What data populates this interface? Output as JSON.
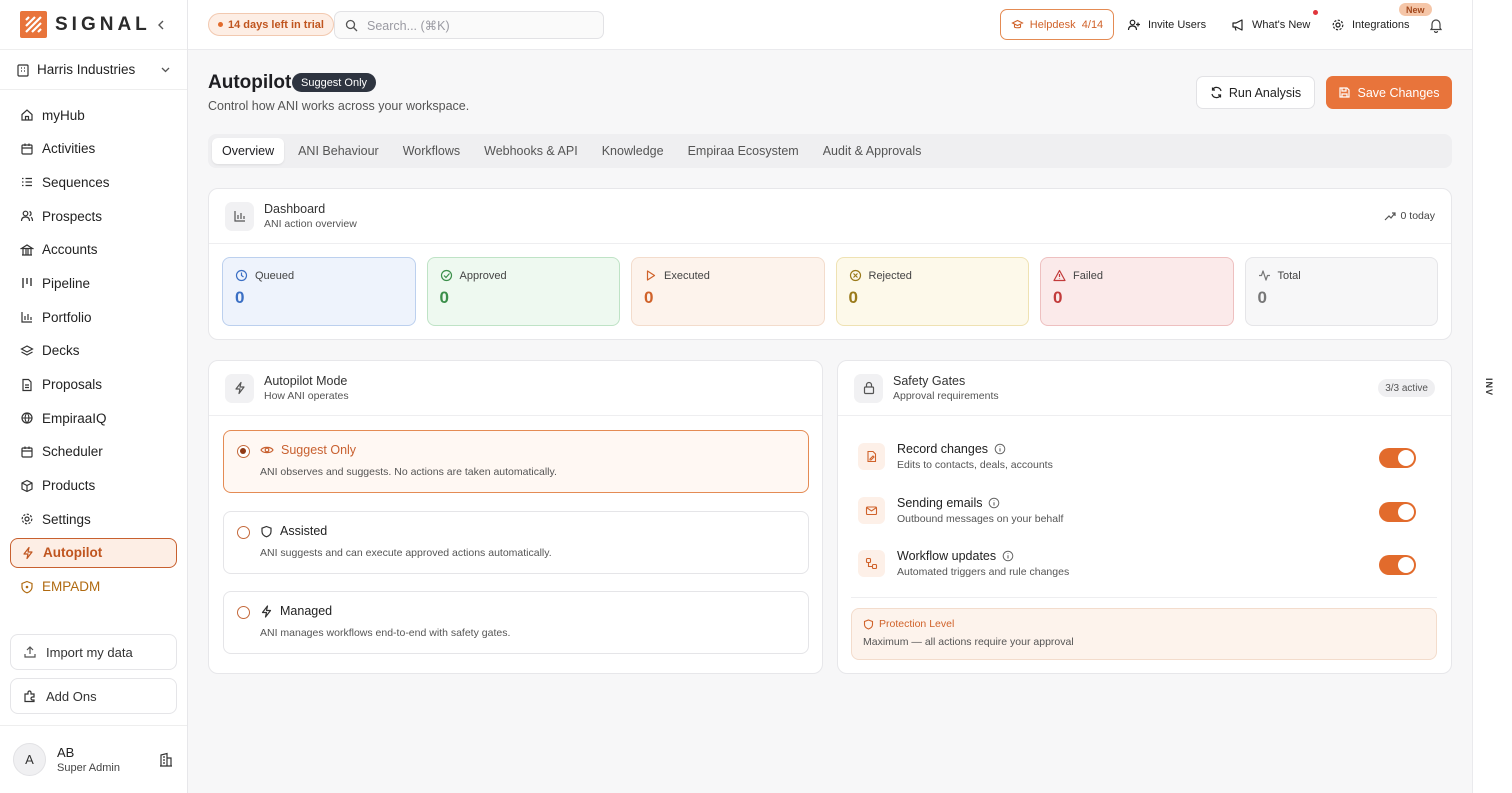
{
  "brand": {
    "name": "SIGNAL",
    "accent": "#e8743b"
  },
  "workspace": {
    "name": "Harris Industries"
  },
  "sidebar": {
    "items": [
      {
        "label": "myHub",
        "icon": "home-icon"
      },
      {
        "label": "Activities",
        "icon": "calendar-icon"
      },
      {
        "label": "Sequences",
        "icon": "list-icon"
      },
      {
        "label": "Prospects",
        "icon": "users-icon"
      },
      {
        "label": "Accounts",
        "icon": "building-icon"
      },
      {
        "label": "Pipeline",
        "icon": "pipeline-icon"
      },
      {
        "label": "Portfolio",
        "icon": "bar-chart-icon"
      },
      {
        "label": "Decks",
        "icon": "layers-icon"
      },
      {
        "label": "Proposals",
        "icon": "document-icon"
      },
      {
        "label": "EmpiraaIQ",
        "icon": "globe-icon"
      },
      {
        "label": "Scheduler",
        "icon": "calendar-icon"
      },
      {
        "label": "Products",
        "icon": "box-icon"
      },
      {
        "label": "Settings",
        "icon": "gear-icon"
      },
      {
        "label": "Autopilot",
        "icon": "bolt-icon"
      },
      {
        "label": "EMPADM",
        "icon": "shield-icon"
      }
    ],
    "import_label": "Import my data",
    "addons_label": "Add Ons"
  },
  "user": {
    "initial": "A",
    "name": "AB",
    "role": "Super Admin"
  },
  "topbar": {
    "trial": "14 days left in trial",
    "search_placeholder": "Search... (⌘K)",
    "helpdesk": "Helpdesk  4/14",
    "invite": "Invite Users",
    "whats_new": "What's New",
    "integrations": "Integrations",
    "new_badge": "New"
  },
  "page": {
    "title": "Autopilot",
    "mode_badge": "Suggest Only",
    "subtitle": "Control how ANI works across your workspace.",
    "run_label": "Run Analysis",
    "save_label": "Save Changes"
  },
  "tabs": [
    "Overview",
    "ANI Behaviour",
    "Workflows",
    "Webhooks & API",
    "Knowledge",
    "Empiraa Ecosystem",
    "Audit & Approvals"
  ],
  "dashboard": {
    "title": "Dashboard",
    "subtitle": "ANI action overview",
    "today": "0 today",
    "stats": [
      {
        "label": "Queued",
        "value": "0",
        "icon": "clock-icon",
        "bg": "#eef3fc",
        "border": "#bcd0ee",
        "color": "#3b6fc4"
      },
      {
        "label": "Approved",
        "value": "0",
        "icon": "check-circle-icon",
        "bg": "#eef9f0",
        "border": "#bfe3c6",
        "color": "#3b8f4a"
      },
      {
        "label": "Executed",
        "value": "0",
        "icon": "play-icon",
        "bg": "#fdf3ec",
        "border": "#f3dccc",
        "color": "#d0622a"
      },
      {
        "label": "Rejected",
        "value": "0",
        "icon": "x-circle-icon",
        "bg": "#fdf9ea",
        "border": "#efe2b3",
        "color": "#9a7a1a"
      },
      {
        "label": "Failed",
        "value": "0",
        "icon": "alert-triangle-icon",
        "bg": "#fbeaea",
        "border": "#eec0c0",
        "color": "#c23b3b"
      },
      {
        "label": "Total",
        "value": "0",
        "icon": "activity-icon",
        "bg": "#f7f7f8",
        "border": "#e5e5e8",
        "color": "#777"
      }
    ]
  },
  "autopilot_mode": {
    "title": "Autopilot Mode",
    "subtitle": "How ANI operates",
    "options": [
      {
        "name": "Suggest Only",
        "desc": "ANI observes and suggests. No actions are taken automatically.",
        "icon": "eye-icon"
      },
      {
        "name": "Assisted",
        "desc": "ANI suggests and can execute approved actions automatically.",
        "icon": "shield-icon"
      },
      {
        "name": "Managed",
        "desc": "ANI manages workflows end-to-end with safety gates.",
        "icon": "bolt-icon"
      }
    ]
  },
  "safety": {
    "title": "Safety Gates",
    "subtitle": "Approval requirements",
    "badge": "3/3 active",
    "gates": [
      {
        "title": "Record changes",
        "desc": "Edits to contacts, deals, accounts",
        "icon": "file-edit-icon"
      },
      {
        "title": "Sending emails",
        "desc": "Outbound messages on your behalf",
        "icon": "mail-icon"
      },
      {
        "title": "Workflow updates",
        "desc": "Automated triggers and rule changes",
        "icon": "workflow-icon"
      }
    ],
    "protection_title": "Protection Level",
    "protection_desc": "Maximum — all actions require your approval"
  },
  "side_strip": {
    "label": "INV"
  }
}
